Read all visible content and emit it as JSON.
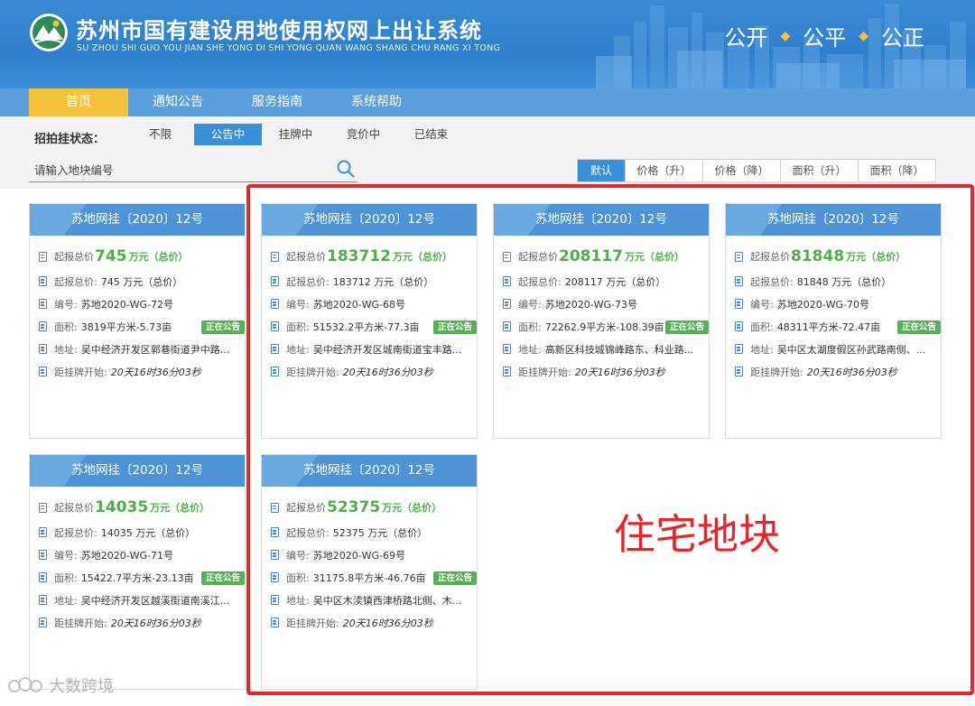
{
  "header": {
    "title": "苏州市国有建设用地使用权网上出让系统",
    "subtitle": "SU ZHOU SHI GUO YOU JIAN SHE YONG DI SHI YONG QUAN WANG SHANG CHU RANG XI TONG",
    "slogan": [
      "公开",
      "公平",
      "公正"
    ],
    "colors": {
      "header_bg": "#2f7fcc",
      "nav_bg": "#5b9fdc",
      "nav_active": "#f5c33b"
    }
  },
  "nav": {
    "items": [
      {
        "label": "首页",
        "active": true
      },
      {
        "label": "通知公告",
        "active": false
      },
      {
        "label": "服务指南",
        "active": false
      },
      {
        "label": "系统帮助",
        "active": false
      }
    ]
  },
  "filter": {
    "status_label": "招拍挂状态：",
    "status_tabs": [
      {
        "label": "不限",
        "active": false
      },
      {
        "label": "公告中",
        "active": true
      },
      {
        "label": "挂牌中",
        "active": false
      },
      {
        "label": "竞价中",
        "active": false
      },
      {
        "label": "已结束",
        "active": false
      }
    ],
    "search_placeholder": "请输入地块编号",
    "search_icon": "search-icon",
    "sort_tabs": [
      {
        "label": "默认",
        "active": true
      },
      {
        "label": "价格（升）",
        "active": false
      },
      {
        "label": "价格（降）",
        "active": false
      },
      {
        "label": "面积（升）",
        "active": false
      },
      {
        "label": "面积（降）",
        "active": false
      }
    ]
  },
  "cards": [
    {
      "title": "苏地网挂〔2020〕12号",
      "price_label": "起报总价",
      "price_big": "745",
      "price_unit": "万元（总价）",
      "price_line_label": "起报总价:",
      "price_line": "745 万元（总价）",
      "code_label": "编号:",
      "code": "苏地2020-WG-72号",
      "area_label": "面积:",
      "area": "3819平方米-5.73亩",
      "badge": "正在公告",
      "address_label": "地址:",
      "address": "吴中经济开发区郭巷街道尹中路...",
      "countdown_label": "距挂牌开始:",
      "countdown": "20天16时36分03秒"
    },
    {
      "title": "苏地网挂〔2020〕12号",
      "price_label": "起报总价",
      "price_big": "183712",
      "price_unit": "万元（总价）",
      "price_line_label": "起报总价:",
      "price_line": "183712 万元（总价）",
      "code_label": "编号:",
      "code": "苏地2020-WG-68号",
      "area_label": "面积:",
      "area": "51532.2平方米-77.3亩",
      "badge": "正在公告",
      "address_label": "地址:",
      "address": "吴中经济开发区城南街道宝丰路...",
      "countdown_label": "距挂牌开始:",
      "countdown": "20天16时36分03秒"
    },
    {
      "title": "苏地网挂〔2020〕12号",
      "price_label": "起报总价",
      "price_big": "208117",
      "price_unit": "万元（总价）",
      "price_line_label": "起报总价:",
      "price_line": "208117 万元（总价）",
      "code_label": "编号:",
      "code": "苏地2020-WG-73号",
      "area_label": "面积:",
      "area": "72262.9平方米-108.39亩",
      "badge": "正在公告",
      "address_label": "地址:",
      "address": "高新区科技城锦峰路东、科业路...",
      "countdown_label": "距挂牌开始:",
      "countdown": "20天16时36分03秒"
    },
    {
      "title": "苏地网挂〔2020〕12号",
      "price_label": "起报总价",
      "price_big": "81848",
      "price_unit": "万元（总价）",
      "price_line_label": "起报总价:",
      "price_line": "81848 万元（总价）",
      "code_label": "编号:",
      "code": "苏地2020-WG-70号",
      "area_label": "面积:",
      "area": "48311平方米-72.47亩",
      "badge": "正在公告",
      "address_label": "地址:",
      "address": "吴中区太湖度假区孙武路南侧、...",
      "countdown_label": "距挂牌开始:",
      "countdown": "20天16时36分03秒"
    },
    {
      "title": "苏地网挂〔2020〕12号",
      "price_label": "起报总价",
      "price_big": "14035",
      "price_unit": "万元（总价）",
      "price_line_label": "起报总价:",
      "price_line": "14035 万元（总价）",
      "code_label": "编号:",
      "code": "苏地2020-WG-71号",
      "area_label": "面积:",
      "area": "15422.7平方米-23.13亩",
      "badge": "正在公告",
      "address_label": "地址:",
      "address": "吴中经济开发区越溪街道南溪江...",
      "countdown_label": "距挂牌开始:",
      "countdown": "20天16时36分03秒"
    },
    {
      "title": "苏地网挂〔2020〕12号",
      "price_label": "起报总价",
      "price_big": "52375",
      "price_unit": "万元（总价）",
      "price_line_label": "起报总价:",
      "price_line": "52375 万元（总价）",
      "code_label": "编号:",
      "code": "苏地2020-WG-69号",
      "area_label": "面积:",
      "area": "31175.8平方米-46.76亩",
      "badge": "正在公告",
      "address_label": "地址:",
      "address": "吴中区木渎镇西津桥路北侧、木...",
      "countdown_label": "距挂牌开始:",
      "countdown": "20天16时36分03秒"
    }
  ],
  "annotation": {
    "text": "住宅地块",
    "color": "#e8262a"
  },
  "watermark": {
    "text": "大数跨境"
  }
}
